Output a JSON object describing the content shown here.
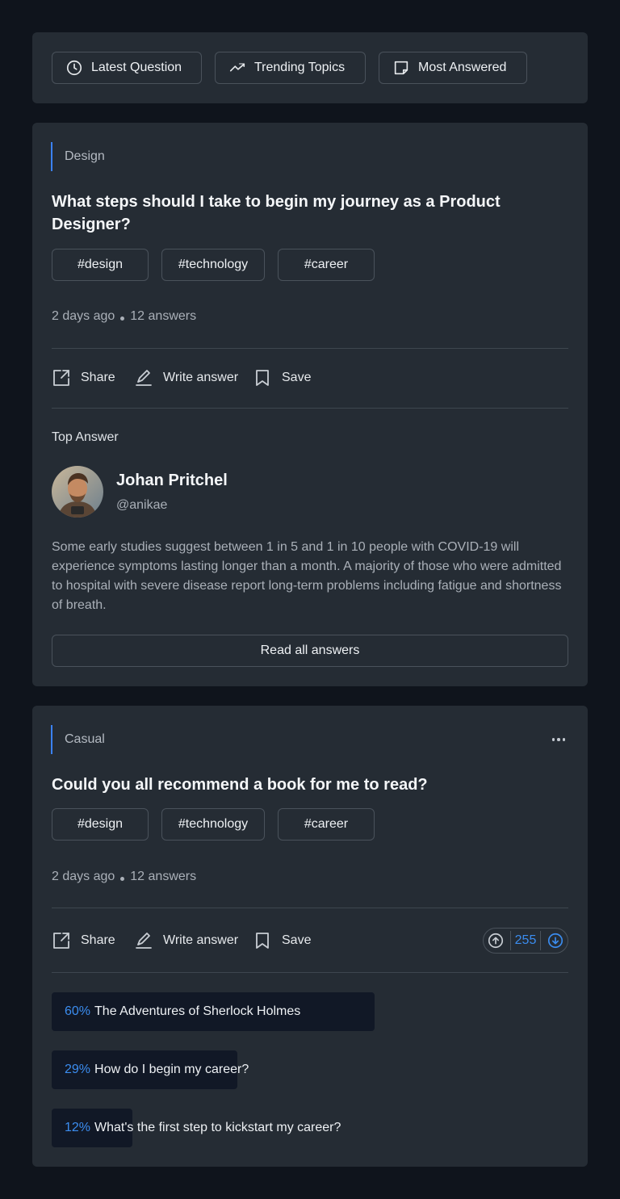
{
  "filters": [
    {
      "label": "Latest Question",
      "icon": "clock-icon"
    },
    {
      "label": "Trending Topics",
      "icon": "trending-up-icon"
    },
    {
      "label": "Most Answered",
      "icon": "note-icon"
    }
  ],
  "posts": [
    {
      "category": "Design",
      "title": "What steps should I take to begin my journey as a Product Designer?",
      "tags": [
        "#design",
        "#technology",
        "#career"
      ],
      "time": "2 days ago",
      "answers": "12 answers",
      "actions": {
        "share": "Share",
        "write": "Write answer",
        "save": "Save"
      },
      "top_answer": {
        "label": "Top Answer",
        "name": "Johan Pritchel",
        "handle": "@anikae",
        "text": "Some early studies suggest between 1 in 5 and 1 in 10 people with COVID-19 will experience symptoms lasting longer than a month. A majority of those who were admitted to hospital with severe disease report long-term problems including fatigue and shortness of breath."
      },
      "read_all": "Read all answers"
    },
    {
      "category": "Casual",
      "title": "Could you all recommend a book for me to read?",
      "tags": [
        "#design",
        "#technology",
        "#career"
      ],
      "time": "2 days ago",
      "answers": "12 answers",
      "actions": {
        "share": "Share",
        "write": "Write answer",
        "save": "Save"
      },
      "votes": "255",
      "poll": [
        {
          "percent": "60%",
          "fraction": 0.625,
          "label": "The Adventures of Sherlock Holmes"
        },
        {
          "percent": "29%",
          "fraction": 0.359,
          "label": "How do I begin my career?"
        },
        {
          "percent": "12%",
          "fraction": 0.156,
          "label": "What's the first step to kickstart my career?"
        }
      ]
    }
  ],
  "colors": {
    "accent": "#3b8df0",
    "background": "#0f141c",
    "card": "#252c34"
  }
}
